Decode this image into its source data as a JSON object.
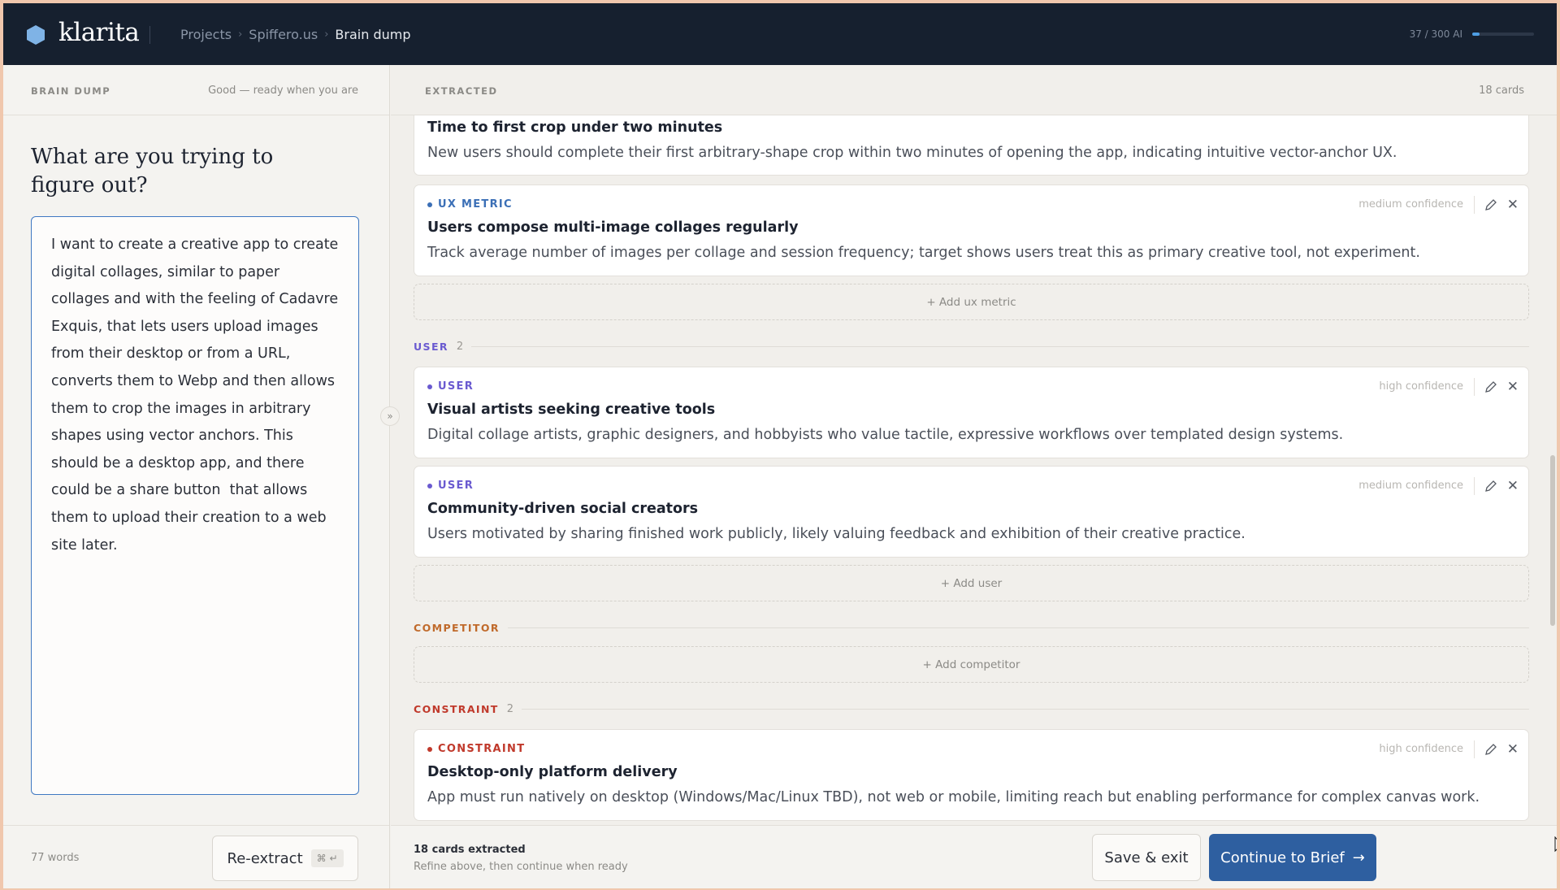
{
  "app": {
    "name": "klarita"
  },
  "breadcrumb": {
    "projects": "Projects",
    "project": "Spiffero.us",
    "current": "Brain dump",
    "separator": "›"
  },
  "usage": {
    "label": "37 / 300 AI",
    "fraction": 0.123
  },
  "left": {
    "label": "BRAIN DUMP",
    "status": "Good — ready when you are",
    "question": "What are you trying to figure out?",
    "dump_text": "I want to create a creative app to create digital collages, similar to paper collages and with the feeling of Cadavre Exquis, that lets users upload images from their desktop or from a URL, converts them to Webp and then allows them to crop the images in arbitrary shapes using vector anchors. This should be a desktop app, and there could be a share button  that allows them to upload their creation to a web site later.",
    "word_count": "77 words",
    "reextract_label": "Re-extract",
    "reextract_shortcut": "⌘ ↵",
    "collapse_glyph": "»"
  },
  "right": {
    "label": "EXTRACTED",
    "card_count": "18 cards",
    "cards": [
      {
        "title": "Time to first crop under two minutes",
        "desc": "New users should complete their first arbitrary-shape crop within two minutes of opening the app, indicating intuitive vector-anchor UX."
      },
      {
        "tag": "UX METRIC",
        "confidence": "medium confidence",
        "title": "Users compose multi-image collages regularly",
        "desc": "Track average number of images per collage and session frequency; target shows users treat this as primary creative tool, not experiment."
      },
      {
        "tag": "USER",
        "confidence": "high confidence",
        "title": "Visual artists seeking creative tools",
        "desc": "Digital collage artists, graphic designers, and hobbyists who value tactile, expressive workflows over templated design systems."
      },
      {
        "tag": "USER",
        "confidence": "medium confidence",
        "title": "Community-driven social creators",
        "desc": "Users motivated by sharing finished work publicly, likely valuing feedback and exhibition of their creative practice."
      },
      {
        "tag": "CONSTRAINT",
        "confidence": "high confidence",
        "title": "Desktop-only platform delivery",
        "desc": "App must run natively on desktop (Windows/Mac/Linux TBD), not web or mobile, limiting reach but enabling performance for complex canvas work."
      }
    ],
    "add_labels": {
      "ux_metric": "+ Add ux metric",
      "user": "+ Add user",
      "competitor": "+ Add competitor"
    },
    "sections": {
      "user": {
        "name": "USER",
        "count": "2"
      },
      "competitor": {
        "name": "COMPETITOR"
      },
      "constraint": {
        "name": "CONSTRAINT",
        "count": "2"
      }
    },
    "footer": {
      "count": "18 cards extracted",
      "hint": "Refine above, then continue when ready"
    },
    "save_exit": "Save & exit",
    "continue": "Continue to Brief",
    "continue_arrow": "→",
    "close_glyph": "✕"
  },
  "colors": {
    "ux_metric": "#3b6fb6",
    "user": "#6a5ad0",
    "competitor": "#c06a2b",
    "constraint": "#c0392b",
    "accent": "#2e5fa0",
    "logo": "#7fb3e6"
  }
}
